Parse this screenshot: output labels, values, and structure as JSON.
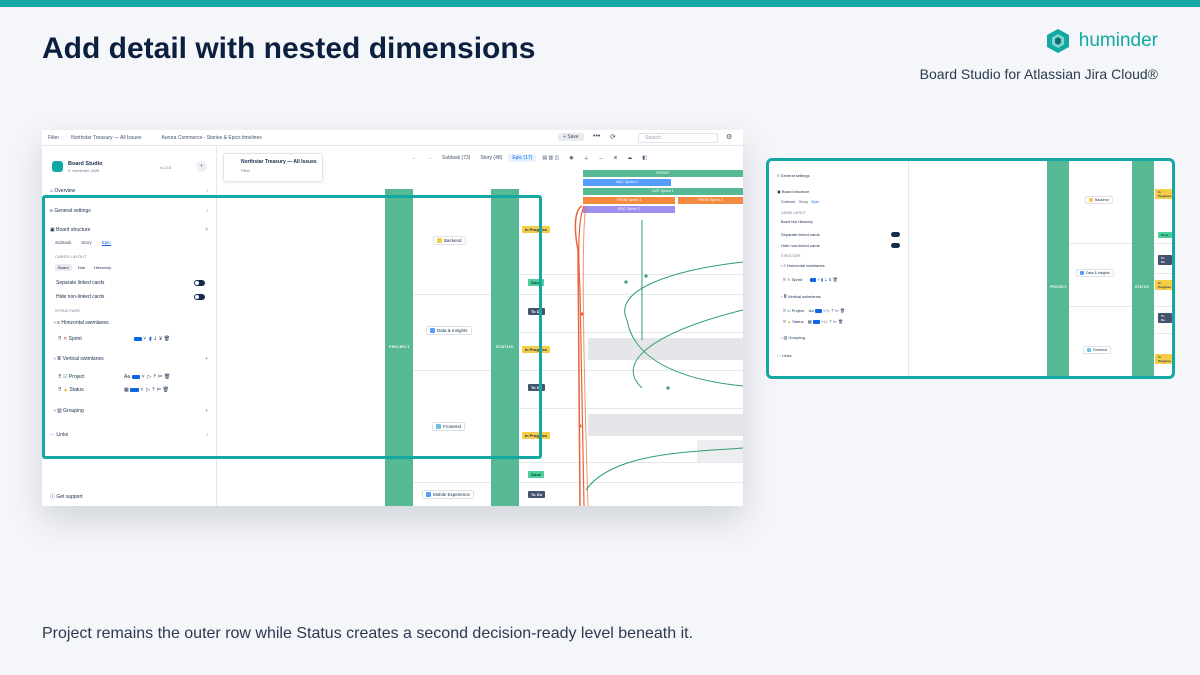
{
  "page": {
    "title": "Add detail with nested dimensions",
    "brand_name": "huminder",
    "subtitle": "Board Studio for Atlassian Jira Cloud®",
    "caption": "Project remains the outer row while Status creates a second decision-ready level beneath it.",
    "accent_color": "#13a8a3"
  },
  "app": {
    "topbar": {
      "filter_label": "Filter",
      "filter_value": "Northstar Treasury — All Issues",
      "board_value": "Aurora Commerce - Stories & Epics timelines",
      "save_label": "Save",
      "search_placeholder": "Search"
    },
    "sidebar": {
      "app_name": "Board Studio",
      "app_by": "© Huminder 2026",
      "version": "v1.3.6",
      "overview": "Overview",
      "general_settings": "General settings",
      "board_structure": "Board structure",
      "tabs": [
        "Subtask",
        "Story",
        "Epic"
      ],
      "cards_layout_label": "CARDS LAYOUT",
      "layout_options": [
        "Board",
        "Hub",
        "Hierarchy"
      ],
      "separate_linked": "Separate linked cards",
      "hide_non_linked": "Hide non-linked cards",
      "structure_label": "STRUCTURE",
      "horizontal_swimlanes": "Horizontal swimlanes",
      "sprint_row": "Sprint",
      "vertical_swimlanes": "Vertical swimlanes",
      "project_row": "Project",
      "status_row": "Status",
      "grouping": "Grouping",
      "links": "Links",
      "get_support": "Get support"
    },
    "epic_filter": {
      "title": "Northstar Treasury — All Issues",
      "sub": "Filter"
    },
    "toolbar": {
      "subtask": "Subtask (73)",
      "story": "Story (48)",
      "epic": "Epic (17)"
    },
    "board": {
      "project_col": "PROJECT",
      "status_col": "STATUS",
      "lanes": [
        "Backend",
        "Data & Insights",
        "Frontend",
        "Mobile Experience"
      ],
      "statuses": [
        "In Progress",
        "Done",
        "To Do",
        "In Progress",
        "To Do",
        "In Progress",
        "Done",
        "To Do"
      ],
      "sprint_header": "SPRINT",
      "bars": [
        "AAC Sprint 1",
        "DAT Sprint 1",
        "FRON Sprint 1",
        "FRON Sprint 2",
        "EEC Sprint 1"
      ]
    }
  }
}
